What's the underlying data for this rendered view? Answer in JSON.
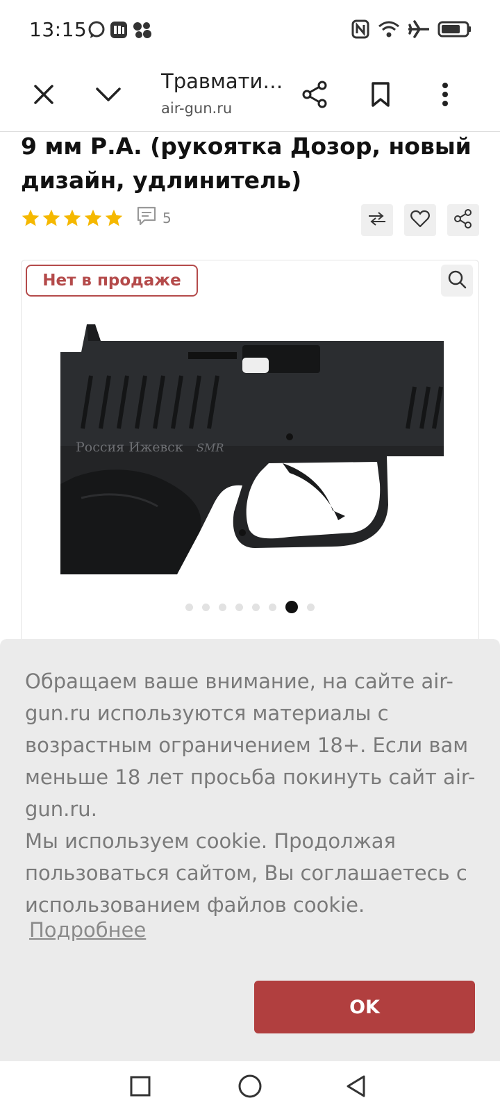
{
  "status_bar": {
    "time": "13:15",
    "left_icons": [
      "chat-bubble-icon",
      "messenger-app-icon",
      "apps-cluster-icon"
    ],
    "right_icons": [
      "nfc-icon",
      "wifi-icon",
      "airplane-icon",
      "battery-icon"
    ]
  },
  "browser": {
    "title": "Травмати…",
    "domain": "air-gun.ru",
    "icons": [
      "close-icon",
      "chevron-down-icon",
      "share-icon",
      "bookmark-icon",
      "more-vert-icon"
    ]
  },
  "product": {
    "title": "9 мм Р.А. (рукоятка Дозор, новый дизайн, удлинитель)",
    "rating_stars": 5,
    "review_count": "5",
    "star_color": "#f5b800",
    "availability_badge": "Нет в продаже",
    "image_engraving": "Россия Ижевск",
    "image_engraving_logo": "SMR",
    "gallery_total": 8,
    "gallery_active_index": 6
  },
  "cookie": {
    "paragraph_1": "Обращаем ваше внимание, на сайте air-gun.ru используются материалы с возрастным ограничением 18+. Если вам меньше 18 лет просьба покинуть сайт air-gun.ru.",
    "paragraph_2": "Мы используем cookie. Продолжая пользоваться сайтом, Вы соглашаетесь с использованием файлов cookie.",
    "more_link": "Подробнее",
    "ok_button": "OK",
    "accent_color": "#b13f3f"
  },
  "nav_bar": {
    "icons": [
      "recents-square-icon",
      "home-circle-icon",
      "back-triangle-icon"
    ]
  }
}
